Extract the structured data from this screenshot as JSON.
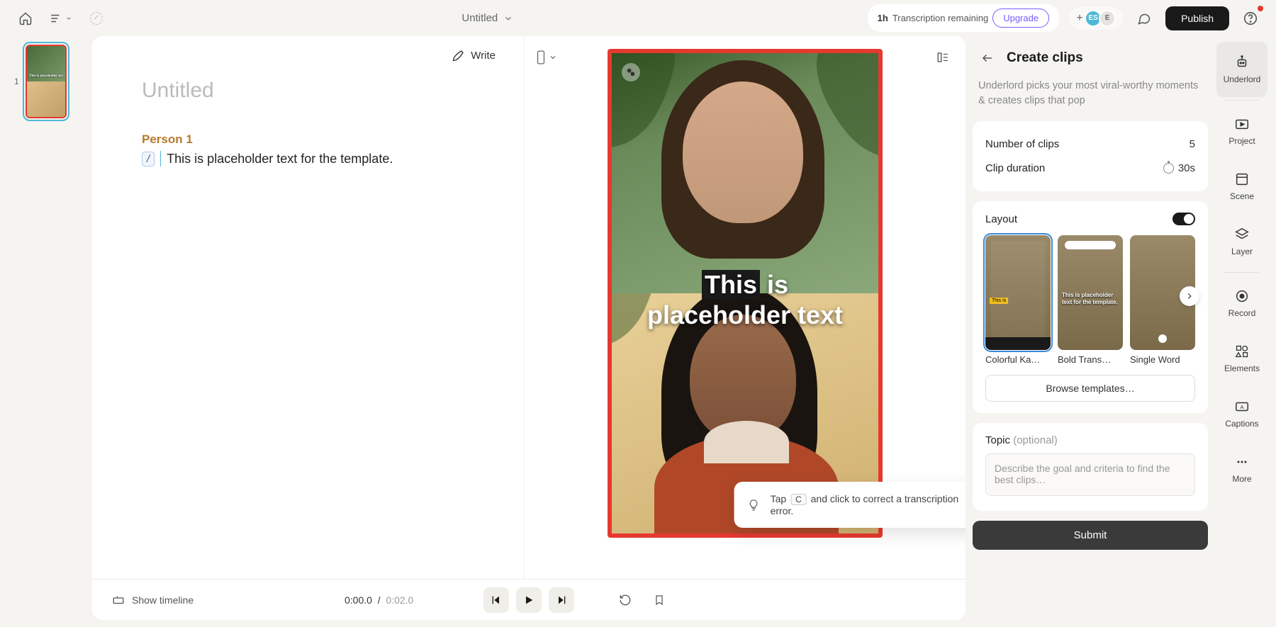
{
  "topbar": {
    "doc_title": "Untitled",
    "transcription_remaining_qty": "1h",
    "transcription_remaining_label": "Transcription remaining",
    "upgrade": "Upgrade",
    "avatar_a": "ES",
    "avatar_b": "E",
    "publish": "Publish"
  },
  "scene": {
    "index": "1",
    "thumb_caption": "This is placeholder tex"
  },
  "transcript": {
    "write": "Write",
    "title_placeholder": "Untitled",
    "speaker": "Person 1",
    "slash": "/",
    "line": "This is placeholder text for the template."
  },
  "preview": {
    "caption_line1_word1": "This",
    "caption_line1_word2": "is",
    "caption_line2": "placeholder text"
  },
  "tip": {
    "pre": "Tap",
    "key": "C",
    "post": "and click to correct a transcription error."
  },
  "playbar": {
    "show_timeline": "Show timeline",
    "current": "0:00.0",
    "sep": "/",
    "total": "0:02.0"
  },
  "panel": {
    "title": "Create clips",
    "desc": "Underlord picks your most viral-worthy moments & creates clips that pop",
    "num_clips_label": "Number of clips",
    "num_clips_value": "5",
    "duration_label": "Clip duration",
    "duration_value": "30s",
    "layout_label": "Layout",
    "layouts": [
      {
        "label": "Colorful Ka…"
      },
      {
        "label": "Bold Trans…",
        "overlay": "This is placeholder text for the template."
      },
      {
        "label": "Single Word"
      }
    ],
    "browse": "Browse templates…",
    "topic_label": "Topic",
    "topic_optional": "(optional)",
    "topic_placeholder": "Describe the goal and criteria to find the best clips…",
    "submit": "Submit"
  },
  "rail": {
    "underlord": "Underlord",
    "project": "Project",
    "scene": "Scene",
    "layer": "Layer",
    "record": "Record",
    "elements": "Elements",
    "captions": "Captions",
    "more": "More"
  }
}
